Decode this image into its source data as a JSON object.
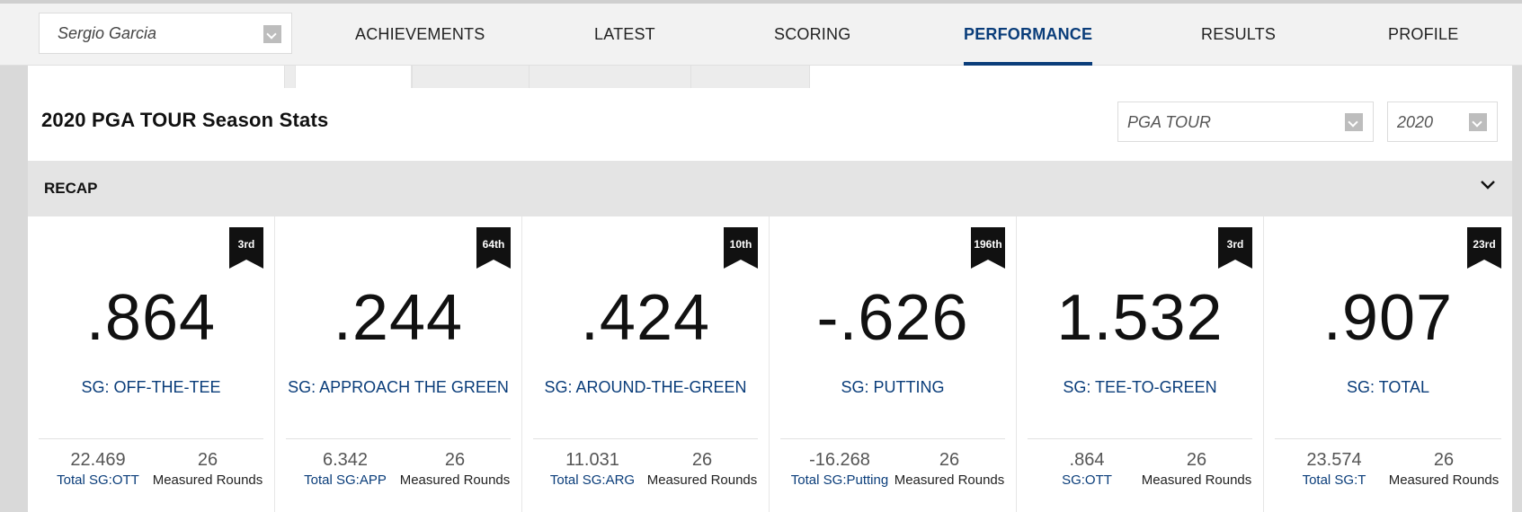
{
  "topnav": {
    "player": "Sergio Garcia",
    "items": [
      {
        "label": "ACHIEVEMENTS",
        "active": false
      },
      {
        "label": "LATEST",
        "active": false
      },
      {
        "label": "SCORING",
        "active": false
      },
      {
        "label": "PERFORMANCE",
        "active": true
      },
      {
        "label": "RESULTS",
        "active": false
      },
      {
        "label": "PROFILE",
        "active": false
      }
    ]
  },
  "season": {
    "title": "2020 PGA TOUR Season Stats",
    "tour": "PGA TOUR",
    "year": "2020"
  },
  "recap": {
    "label": "RECAP"
  },
  "stats": [
    {
      "rank": "3rd",
      "value": ".864",
      "label": "SG: OFF-THE-TEE",
      "sub_left_value": "22.469",
      "sub_left_label": "Total SG:OTT",
      "sub_right_value": "26",
      "sub_right_label": "Measured Rounds"
    },
    {
      "rank": "64th",
      "value": ".244",
      "label": "SG: APPROACH THE GREEN",
      "sub_left_value": "6.342",
      "sub_left_label": "Total SG:APP",
      "sub_right_value": "26",
      "sub_right_label": "Measured Rounds"
    },
    {
      "rank": "10th",
      "value": ".424",
      "label": "SG: AROUND-THE-GREEN",
      "sub_left_value": "11.031",
      "sub_left_label": "Total SG:ARG",
      "sub_right_value": "26",
      "sub_right_label": "Measured Rounds"
    },
    {
      "rank": "196th",
      "value": "-.626",
      "label": "SG: PUTTING",
      "sub_left_value": "-16.268",
      "sub_left_label": "Total SG:Putting",
      "sub_right_value": "26",
      "sub_right_label": "Measured Rounds"
    },
    {
      "rank": "3rd",
      "value": "1.532",
      "label": "SG: TEE-TO-GREEN",
      "sub_left_value": ".864",
      "sub_left_label": "SG:OTT",
      "sub_right_value": "26",
      "sub_right_label": "Measured Rounds"
    },
    {
      "rank": "23rd",
      "value": ".907",
      "label": "SG: TOTAL",
      "sub_left_value": "23.574",
      "sub_left_label": "Total SG:T",
      "sub_right_value": "26",
      "sub_right_label": "Measured Rounds"
    }
  ],
  "colors": {
    "accent": "#0a3d7a",
    "rank_badge": "#111111"
  }
}
